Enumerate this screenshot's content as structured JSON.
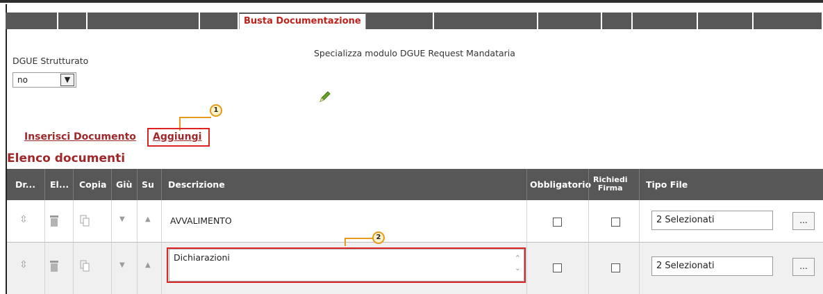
{
  "tabs": {
    "active_label": "Busta Documentazione"
  },
  "dgue": {
    "label": "DGUE Strutturato",
    "select_value": "no",
    "specializza_label": "Specializza modulo DGUE Request Mandataria"
  },
  "actions": {
    "inserisci_label": "Inserisci Documento",
    "aggiungi_label": "Aggiungi"
  },
  "callouts": {
    "one": "1",
    "two": "2"
  },
  "section": {
    "title": "Elenco documenti"
  },
  "table": {
    "headers": {
      "drag": "Dr...",
      "elimina": "El...",
      "copia": "Copia",
      "giu": "Giù",
      "su": "Su",
      "descrizione": "Descrizione",
      "obbligatorio": "Obbligatorio",
      "richiedi": "Richiedi",
      "firma": "Firma",
      "tipo_file": "Tipo File"
    },
    "rows": [
      {
        "descrizione": "AVVALIMENTO",
        "tipo_file": "2 Selezionati",
        "dots": "..."
      },
      {
        "descrizione": "Dichiarazioni",
        "tipo_file": "2 Selezionati",
        "dots": "..."
      }
    ]
  },
  "colors": {
    "accent": "#a0282a",
    "header_bg": "#575757",
    "highlight": "#dd2222",
    "callout": "#e59a1b"
  }
}
